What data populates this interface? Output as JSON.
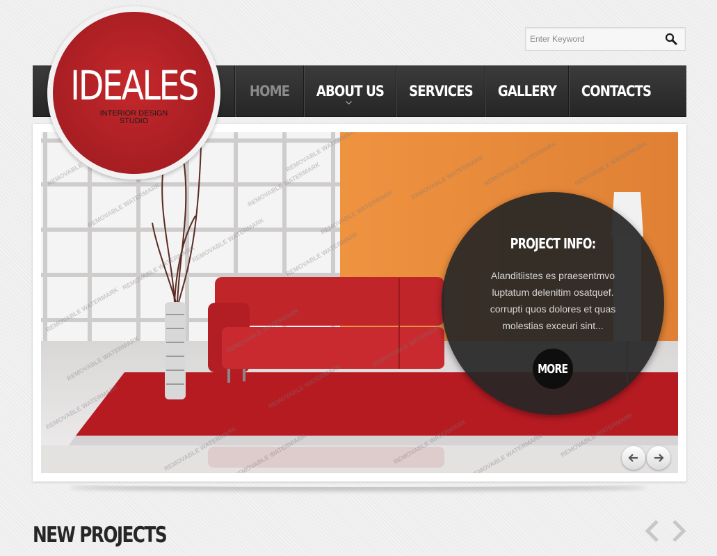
{
  "search": {
    "placeholder": "Enter Keyword",
    "icon": "search-icon"
  },
  "logo": {
    "title": "IDEALES",
    "subtitle_line1": "INTERIOR DESIGN",
    "subtitle_line2": "STUDIO",
    "color": "#b22227"
  },
  "nav": {
    "items": [
      {
        "label": "HOME",
        "active": true
      },
      {
        "label": "ABOUT US",
        "active": false
      },
      {
        "label": "SERVICES",
        "active": false
      },
      {
        "label": "GALLERY",
        "active": false
      },
      {
        "label": "CONTACTS",
        "active": false
      }
    ]
  },
  "slider": {
    "watermark": "REMOVABLE WATERMARK",
    "info": {
      "title": "PROJECT INFO:",
      "text": "Alanditiistes es praesentmvo luptatum delenitim osatquef. corrupti quos dolores et quas molestias exceuri sint...",
      "more_label": "MORE"
    },
    "prev_icon": "arrow-left-icon",
    "next_icon": "arrow-right-icon"
  },
  "new_projects": {
    "title": "NEW PROJECTS",
    "prev_icon": "chevron-left-icon",
    "next_icon": "chevron-right-icon"
  }
}
